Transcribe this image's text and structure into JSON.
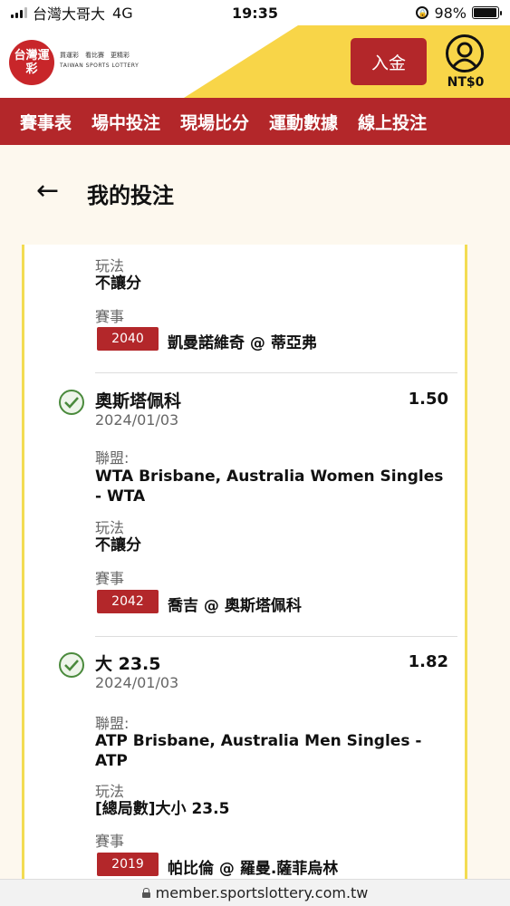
{
  "status_bar": {
    "carrier": "台灣大哥大",
    "network": "4G",
    "time": "19:35",
    "battery": "98%"
  },
  "header": {
    "logo_text": "台灣運彩",
    "logo_slogan": "買運彩　看比賽　更精彩",
    "logo_en": "TAIWAN SPORTS LOTTERY",
    "deposit_label": "入金",
    "balance": "NT$0"
  },
  "nav": {
    "items": [
      "賽事表",
      "場中投注",
      "現場比分",
      "運動數據",
      "線上投注"
    ]
  },
  "page": {
    "title": "我的投注"
  },
  "labels": {
    "play": "玩法",
    "event": "賽事",
    "league": "聯盟:"
  },
  "bets": {
    "top_partial": {
      "play_value": "不讓分",
      "game_code": "2040",
      "matchup": "凱曼諾維奇 @ 蒂亞弗"
    },
    "items": [
      {
        "selection": "奧斯塔佩科",
        "odds": "1.50",
        "date": "2024/01/03",
        "league_line1": "WTA Brisbane, Australia Women Singles",
        "league_line2": "- WTA",
        "play_value": "不讓分",
        "game_code": "2042",
        "matchup": "喬吉 @ 奧斯塔佩科"
      },
      {
        "selection": "大 23.5",
        "odds": "1.82",
        "date": "2024/01/03",
        "league_line1": "ATP Brisbane, Australia Men Singles -",
        "league_line2": "ATP",
        "play_value": "[總局數]大小 23.5",
        "game_code": "2019",
        "matchup": "帕比倫 @ 羅曼.薩菲烏林"
      }
    ]
  },
  "browser": {
    "url": "member.sportslottery.com.tw"
  },
  "colors": {
    "brand_red": "#b3272a",
    "accent_yellow": "#f8d548",
    "success_green": "#4a8a3c"
  }
}
